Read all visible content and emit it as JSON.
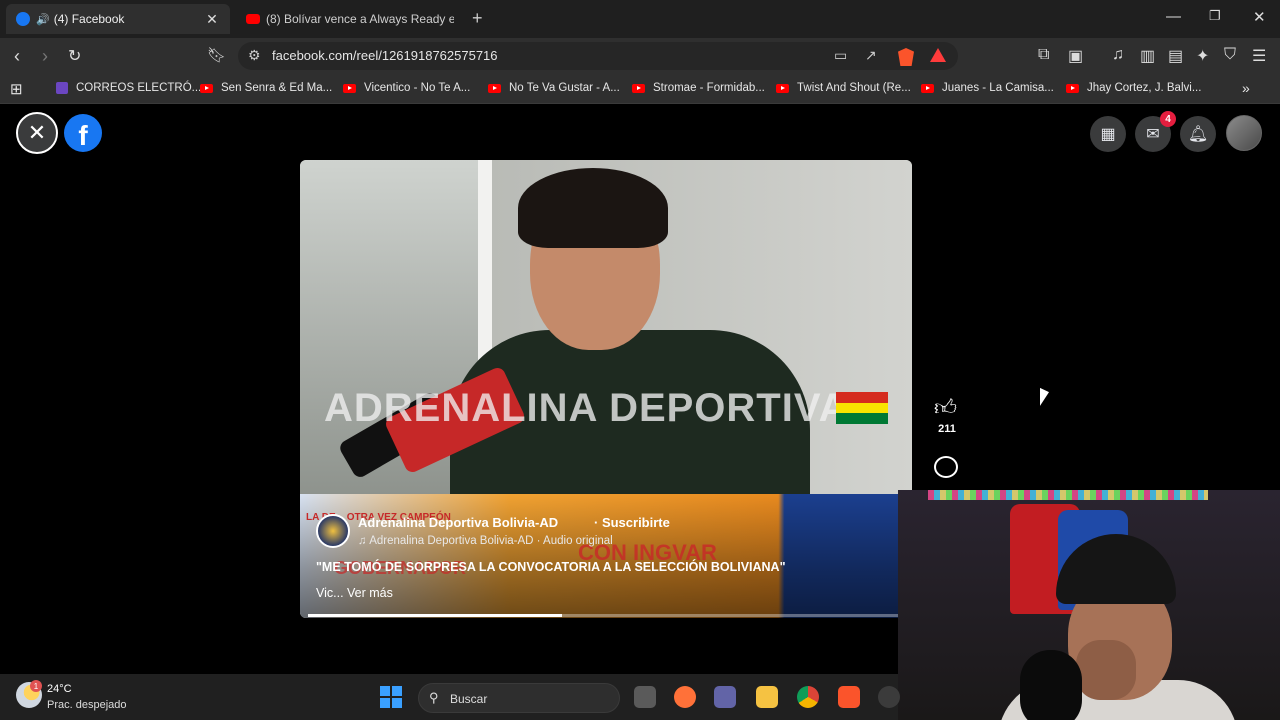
{
  "browser": {
    "tabs": [
      {
        "title": "(4) Facebook",
        "active": true
      },
      {
        "title": "(8) Bolívar vence a Always Ready en I",
        "active": false
      }
    ],
    "url": "facebook.com/reel/1261918762575716",
    "bookmarks": [
      "CORREOS ELECTRÓ...",
      "Sen Senra & Ed Ma...",
      "Vicentico - No Te A...",
      "No Te Va Gustar - A...",
      "Stromae - Formidab...",
      "Twist And Shout (Re...",
      "Juanes - La Camisa...",
      "Jhay Cortez, J. Balvi..."
    ]
  },
  "facebook": {
    "logo": "f",
    "notification_badge": "4",
    "icons": [
      "close-icon",
      "menu-grid-icon",
      "messenger-icon",
      "bell-icon"
    ]
  },
  "reel": {
    "watermark": "ADRENALINA DEPORTIVA",
    "banner_top": "LA DE... OTRA VEZ CAMPEÓN",
    "banner_big1": "CON INGVAR",
    "banner_big2": "GOBERNADOR",
    "channel": "Adrenalina Deportiva Bolivia-AD",
    "subscribe": "· Suscribirte",
    "audio": "Adrenalina Deportiva Bolivia-AD · Audio original",
    "caption": "\"ME TOMÓ DE SORPRESA LA CONVOCATORIA A LA SELECCIÓN BOLIVIANA\"",
    "see_more": "Vic... Ver más",
    "likes": "211",
    "progress": 0.43
  },
  "taskbar": {
    "temperature": "24°C",
    "condition": "Prac. despejado",
    "weather_badge": "1",
    "search_placeholder": "Buscar"
  }
}
